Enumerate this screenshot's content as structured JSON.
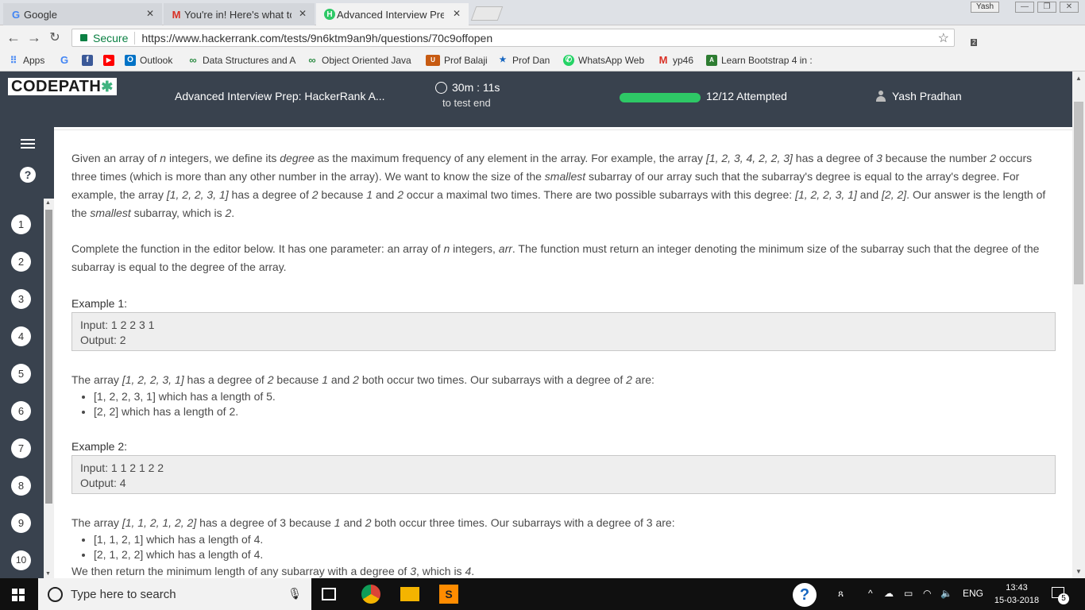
{
  "browser": {
    "tabs": [
      {
        "title": "Google",
        "favicon": "G"
      },
      {
        "title": "You're in! Here's what to",
        "favicon": "M"
      },
      {
        "title": "Advanced Interview Prep",
        "favicon": "H"
      }
    ],
    "user_badge": "Yash",
    "secure_label": "Secure",
    "url": "https://www.hackerrank.com/tests/9n6ktm9an9h/questions/70c9offopen",
    "ext_badge": "2"
  },
  "bookmarks": [
    {
      "label": "Apps",
      "icon": "apps-grid-icon",
      "color": "#4285f4"
    },
    {
      "label": "",
      "icon": "google-icon",
      "glyph": "G",
      "color": "#4285f4"
    },
    {
      "label": "",
      "icon": "facebook-icon",
      "glyph": "f",
      "color": "#3b5998"
    },
    {
      "label": "",
      "icon": "youtube-icon",
      "glyph": "▶",
      "color": "#ff0000"
    },
    {
      "label": "Outlook",
      "icon": "outlook-icon",
      "glyph": "O",
      "color": "#0072c6"
    },
    {
      "label": "Data Structures and A",
      "icon": "geeks-icon",
      "glyph": "∞",
      "color": "#2f8d46"
    },
    {
      "label": "Object Oriented Java",
      "icon": "geeks-icon",
      "glyph": "∞",
      "color": "#2f8d46"
    },
    {
      "label": "Prof Balaji",
      "icon": "utd-icon",
      "glyph": "U",
      "color": "#c75b12"
    },
    {
      "label": "Prof Dan",
      "icon": "profile-icon",
      "glyph": "★",
      "color": "#1565c0"
    },
    {
      "label": "WhatsApp Web",
      "icon": "whatsapp-icon",
      "glyph": "✆",
      "color": "#25d366"
    },
    {
      "label": "yp46",
      "icon": "gmail-icon",
      "glyph": "M",
      "color": "#d93025"
    },
    {
      "label": "Learn Bootstrap 4 in :",
      "icon": "bootstrap-icon",
      "glyph": "A",
      "color": "#2e7d32"
    }
  ],
  "header": {
    "logo": "CODEPATH",
    "test_name": "Advanced Interview Prep: HackerRank A...",
    "timer": "30m : 11s",
    "timer_sub": "to test end",
    "progress_fraction": 1.0,
    "attempted": "12/12 Attempted",
    "user_name": "Yash Pradhan"
  },
  "sidebar": {
    "help": "?",
    "questions": [
      "1",
      "2",
      "3",
      "4",
      "5",
      "6",
      "7",
      "8",
      "9",
      "10"
    ]
  },
  "content": {
    "example1_label": "Example 1:",
    "example1_input": "Input: 1 2 2 3 1",
    "example1_output": "Output: 2",
    "example1_bullets": [
      "[1, 2, 2, 3, 1] which has a length of 5.",
      "[2, 2] which has a length of 2."
    ],
    "example2_label": "Example 2:",
    "example2_input": "Input: 1 1 2 1 2 2",
    "example2_output": "Output: 4",
    "example2_bullets": [
      "[1, 1, 2, 1] which has a length of 4.",
      "[2, 1, 2, 2] which has a length of 4."
    ]
  },
  "taskbar": {
    "search_placeholder": "Type here to search",
    "lang": "ENG",
    "time": "13:43",
    "date": "15-03-2018",
    "notif_count": "5"
  }
}
